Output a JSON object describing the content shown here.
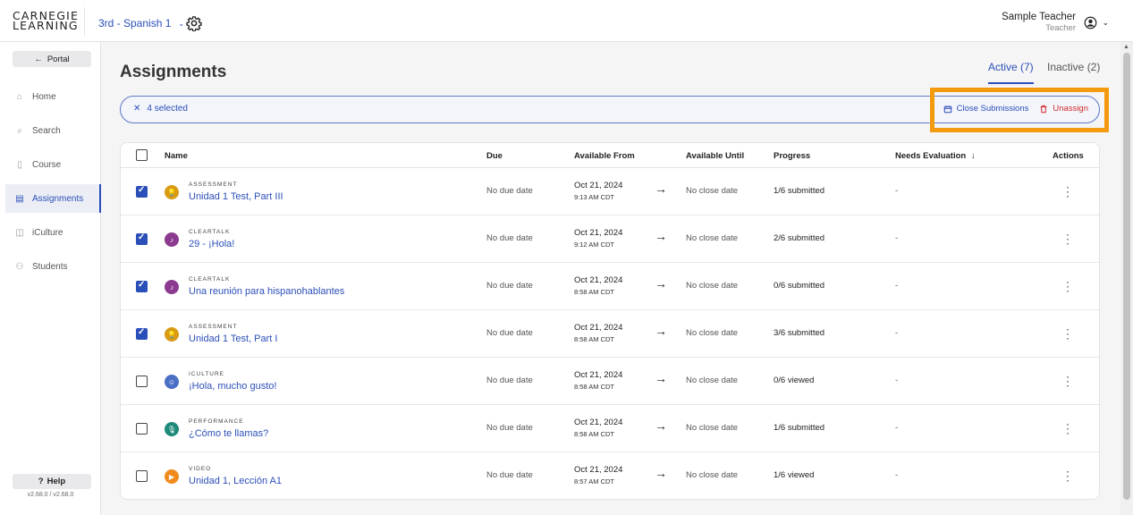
{
  "header": {
    "logo_line1": "CARNEGIE",
    "logo_line2": "LEARNING",
    "course": "3rd - Spanish 1",
    "user_name": "Sample Teacher",
    "user_role": "Teacher"
  },
  "sidebar": {
    "portal_label": "Portal",
    "items": [
      {
        "label": "Home",
        "icon": "home-icon"
      },
      {
        "label": "Search",
        "icon": "search-icon"
      },
      {
        "label": "Course",
        "icon": "course-icon"
      },
      {
        "label": "Assignments",
        "icon": "assignments-icon"
      },
      {
        "label": "iCulture",
        "icon": "iculture-icon"
      },
      {
        "label": "Students",
        "icon": "students-icon"
      }
    ],
    "help_label": "Help",
    "version": "v2.68.0 / v2.68.0"
  },
  "main": {
    "title": "Assignments",
    "tabs": {
      "active": "Active (7)",
      "inactive": "Inactive (2)"
    },
    "selection": {
      "count_label": "4 selected",
      "close_label": "Close Submissions",
      "unassign_label": "Unassign"
    },
    "columns": {
      "name": "Name",
      "due": "Due",
      "available_from": "Available From",
      "available_until": "Available Until",
      "progress": "Progress",
      "needs_evaluation": "Needs Evaluation",
      "actions": "Actions"
    },
    "rows": [
      {
        "type": "ASSESSMENT",
        "name": "Unidad 1 Test, Part III",
        "due": "No due date",
        "from_date": "Oct 21, 2024",
        "from_time": "9:13 AM CDT",
        "until": "No close date",
        "progress": "1/6 submitted",
        "needs": "-"
      },
      {
        "type": "CLEARTALK",
        "name": "29 - ¡Hola!",
        "due": "No due date",
        "from_date": "Oct 21, 2024",
        "from_time": "9:12 AM CDT",
        "until": "No close date",
        "progress": "2/6 submitted",
        "needs": "-"
      },
      {
        "type": "CLEARTALK",
        "name": "Una reunión para hispanohablantes",
        "due": "No due date",
        "from_date": "Oct 21, 2024",
        "from_time": "8:58 AM CDT",
        "until": "No close date",
        "progress": "0/6 submitted",
        "needs": "-"
      },
      {
        "type": "ASSESSMENT",
        "name": "Unidad 1 Test, Part I",
        "due": "No due date",
        "from_date": "Oct 21, 2024",
        "from_time": "8:58 AM CDT",
        "until": "No close date",
        "progress": "3/6 submitted",
        "needs": "-"
      },
      {
        "type": "ICULTURE",
        "name": "¡Hola, mucho gusto!",
        "due": "No due date",
        "from_date": "Oct 21, 2024",
        "from_time": "8:58 AM CDT",
        "until": "No close date",
        "progress": "0/6 viewed",
        "needs": "-"
      },
      {
        "type": "PERFORMANCE",
        "name": "¿Cómo te llamas?",
        "due": "No due date",
        "from_date": "Oct 21, 2024",
        "from_time": "8:58 AM CDT",
        "until": "No close date",
        "progress": "1/6 submitted",
        "needs": "-"
      },
      {
        "type": "VIDEO",
        "name": "Unidad 1, Lección A1",
        "due": "No due date",
        "from_date": "Oct 21, 2024",
        "from_time": "8:57 AM CDT",
        "until": "No close date",
        "progress": "1/6 viewed",
        "needs": "-"
      }
    ]
  },
  "colors": {
    "accent": "#2b4fb8",
    "danger": "#d22a2a",
    "highlight": "#f39a0e",
    "assessment": "#d99a14",
    "cleartalk": "#8b3a8f",
    "iculture": "#4b6fc4",
    "performance": "#1f8a7a",
    "video": "#f08a1c"
  }
}
